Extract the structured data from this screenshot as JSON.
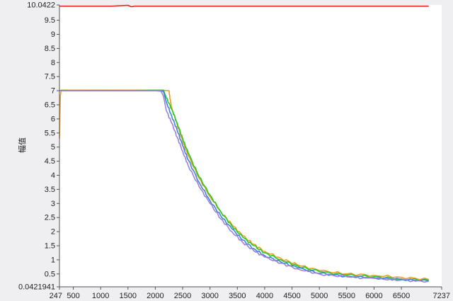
{
  "chart_data": {
    "type": "line",
    "title": "",
    "xlabel": "",
    "ylabel": "幅值",
    "xlim": [
      247,
      7237
    ],
    "ylim": [
      0.0421941,
      10.0422
    ],
    "x_ticks": [
      247,
      500,
      1000,
      1500,
      2000,
      2500,
      3000,
      3500,
      4000,
      4500,
      5000,
      5500,
      6000,
      6500,
      7237
    ],
    "x_tick_labels": [
      "247",
      "500",
      "1000",
      "1500",
      "2000",
      "2500",
      "3000",
      "3500",
      "4000",
      "4500",
      "5000",
      "5500",
      "6000",
      "6500",
      "7237"
    ],
    "y_ticks": [
      0.0421941,
      0.5,
      1,
      1.5,
      2,
      2.5,
      3,
      3.5,
      4,
      4.5,
      5,
      5.5,
      6,
      6.5,
      7,
      7.5,
      8,
      8.5,
      9,
      9.5,
      10.0422
    ],
    "y_tick_labels": [
      "0.0421941",
      "0.5",
      "1",
      "1.5",
      "2",
      "2.5",
      "3",
      "3.5",
      "4",
      "4.5",
      "5",
      "5.5",
      "6",
      "6.5",
      "7",
      "7.5",
      "8",
      "8.5",
      "9",
      "9.5",
      "10.0422"
    ],
    "grid": false,
    "legend": "none",
    "series": [
      {
        "color": "#e02020",
        "x": [
          247,
          1200,
          1500,
          1560,
          1620,
          3000,
          5000,
          7000
        ],
        "y": [
          10.0,
          10.0,
          10.03,
          9.98,
          10.0,
          10.0,
          10.0,
          10.0
        ]
      },
      {
        "color": "#e8a020",
        "x": [
          247,
          262,
          280,
          500,
          1000,
          1500,
          2000,
          2100,
          2250,
          2270,
          2300,
          2400,
          2500,
          2600,
          2800,
          3000,
          3200,
          3400,
          3600,
          3800,
          4000,
          4300,
          4600,
          5000,
          5500,
          6000,
          6500,
          7000
        ],
        "y": [
          5.3,
          6.8,
          7.02,
          7.02,
          7.02,
          7.02,
          7.02,
          7.02,
          7.0,
          6.7,
          6.4,
          5.8,
          5.2,
          4.7,
          3.9,
          3.25,
          2.7,
          2.25,
          1.85,
          1.55,
          1.3,
          1.05,
          0.82,
          0.62,
          0.5,
          0.45,
          0.38,
          0.3
        ]
      },
      {
        "color": "#28c828",
        "x": [
          247,
          300,
          500,
          1000,
          1500,
          2000,
          2150,
          2200,
          2300,
          2400,
          2500,
          2600,
          2800,
          3000,
          3200,
          3400,
          3600,
          3800,
          4000,
          4300,
          4600,
          5000,
          5500,
          6000,
          6500,
          7000
        ],
        "y": [
          7.0,
          7.01,
          7.0,
          7.01,
          7.0,
          7.02,
          7.02,
          6.75,
          6.35,
          5.85,
          5.3,
          4.8,
          3.95,
          3.3,
          2.7,
          2.2,
          1.8,
          1.5,
          1.25,
          1.0,
          0.78,
          0.58,
          0.46,
          0.4,
          0.32,
          0.28
        ]
      },
      {
        "color": "#3c82dc",
        "x": [
          247,
          300,
          500,
          1000,
          1500,
          2000,
          2150,
          2200,
          2300,
          2400,
          2500,
          2600,
          2800,
          3000,
          3200,
          3400,
          3600,
          3800,
          4000,
          4300,
          4600,
          5000,
          5500,
          6000,
          6500,
          7000
        ],
        "y": [
          7.0,
          7.0,
          7.0,
          7.0,
          7.0,
          7.0,
          6.98,
          6.6,
          6.1,
          5.6,
          5.05,
          4.55,
          3.75,
          3.1,
          2.55,
          2.1,
          1.7,
          1.4,
          1.15,
          0.92,
          0.72,
          0.52,
          0.42,
          0.36,
          0.3,
          0.25
        ]
      },
      {
        "color": "#9a82dc",
        "x": [
          247,
          300,
          500,
          1000,
          1500,
          2000,
          2100,
          2150,
          2200,
          2300,
          2400,
          2500,
          2600,
          2800,
          3000,
          3200,
          3400,
          3600,
          3800,
          4000,
          4300,
          4600,
          5000,
          5500,
          6000,
          6500,
          7000
        ],
        "y": [
          7.0,
          7.0,
          7.0,
          7.0,
          7.0,
          7.0,
          7.0,
          6.8,
          6.3,
          5.85,
          5.35,
          4.85,
          4.35,
          3.6,
          3.0,
          2.45,
          2.0,
          1.62,
          1.32,
          1.1,
          0.88,
          0.68,
          0.5,
          0.4,
          0.34,
          0.28,
          0.24
        ]
      }
    ]
  }
}
